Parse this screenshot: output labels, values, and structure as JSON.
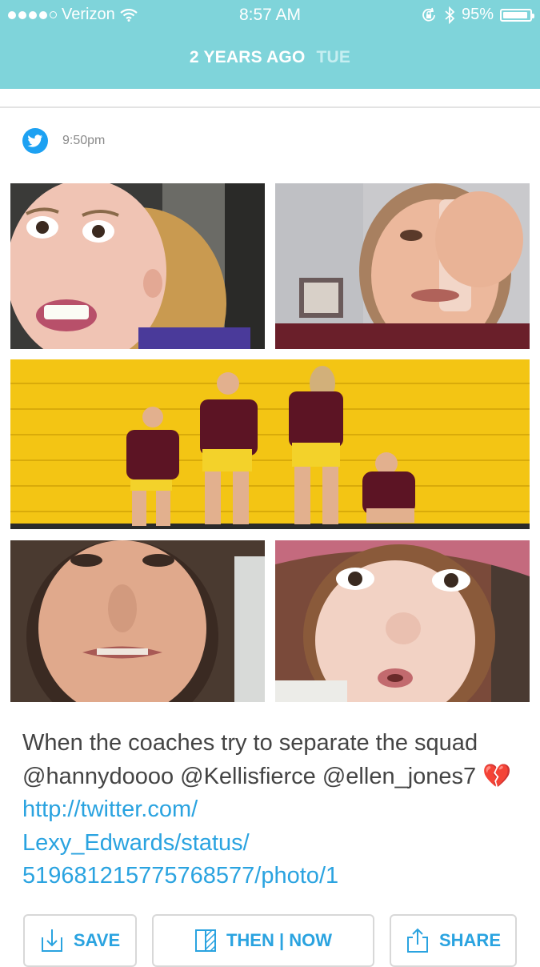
{
  "status_bar": {
    "carrier": "Verizon",
    "time": "8:57 AM",
    "battery": "95%",
    "battery_level": 0.95
  },
  "header": {
    "title": "2 YEARS AGO",
    "day": "TUE"
  },
  "post": {
    "source_icon": "twitter-icon",
    "time": "9:50pm",
    "text_plain": "When the coaches try to separate the squad @hannydoooo @Kellisfierce @ellen_jones7",
    "emoji": "💔",
    "link": "http://twitter.com/Lexy_Edwards/status/519681215775768577/photo/1",
    "link_lines": [
      "http://twitter.com/",
      "Lexy_Edwards/status/",
      "519681215775768577/photo/1"
    ]
  },
  "actions": {
    "save": "SAVE",
    "then_now": "THEN | NOW",
    "share": "SHARE"
  },
  "colors": {
    "header_bg": "#7fd4da",
    "accent": "#2aa3e0",
    "twitter": "#1da1f2"
  }
}
